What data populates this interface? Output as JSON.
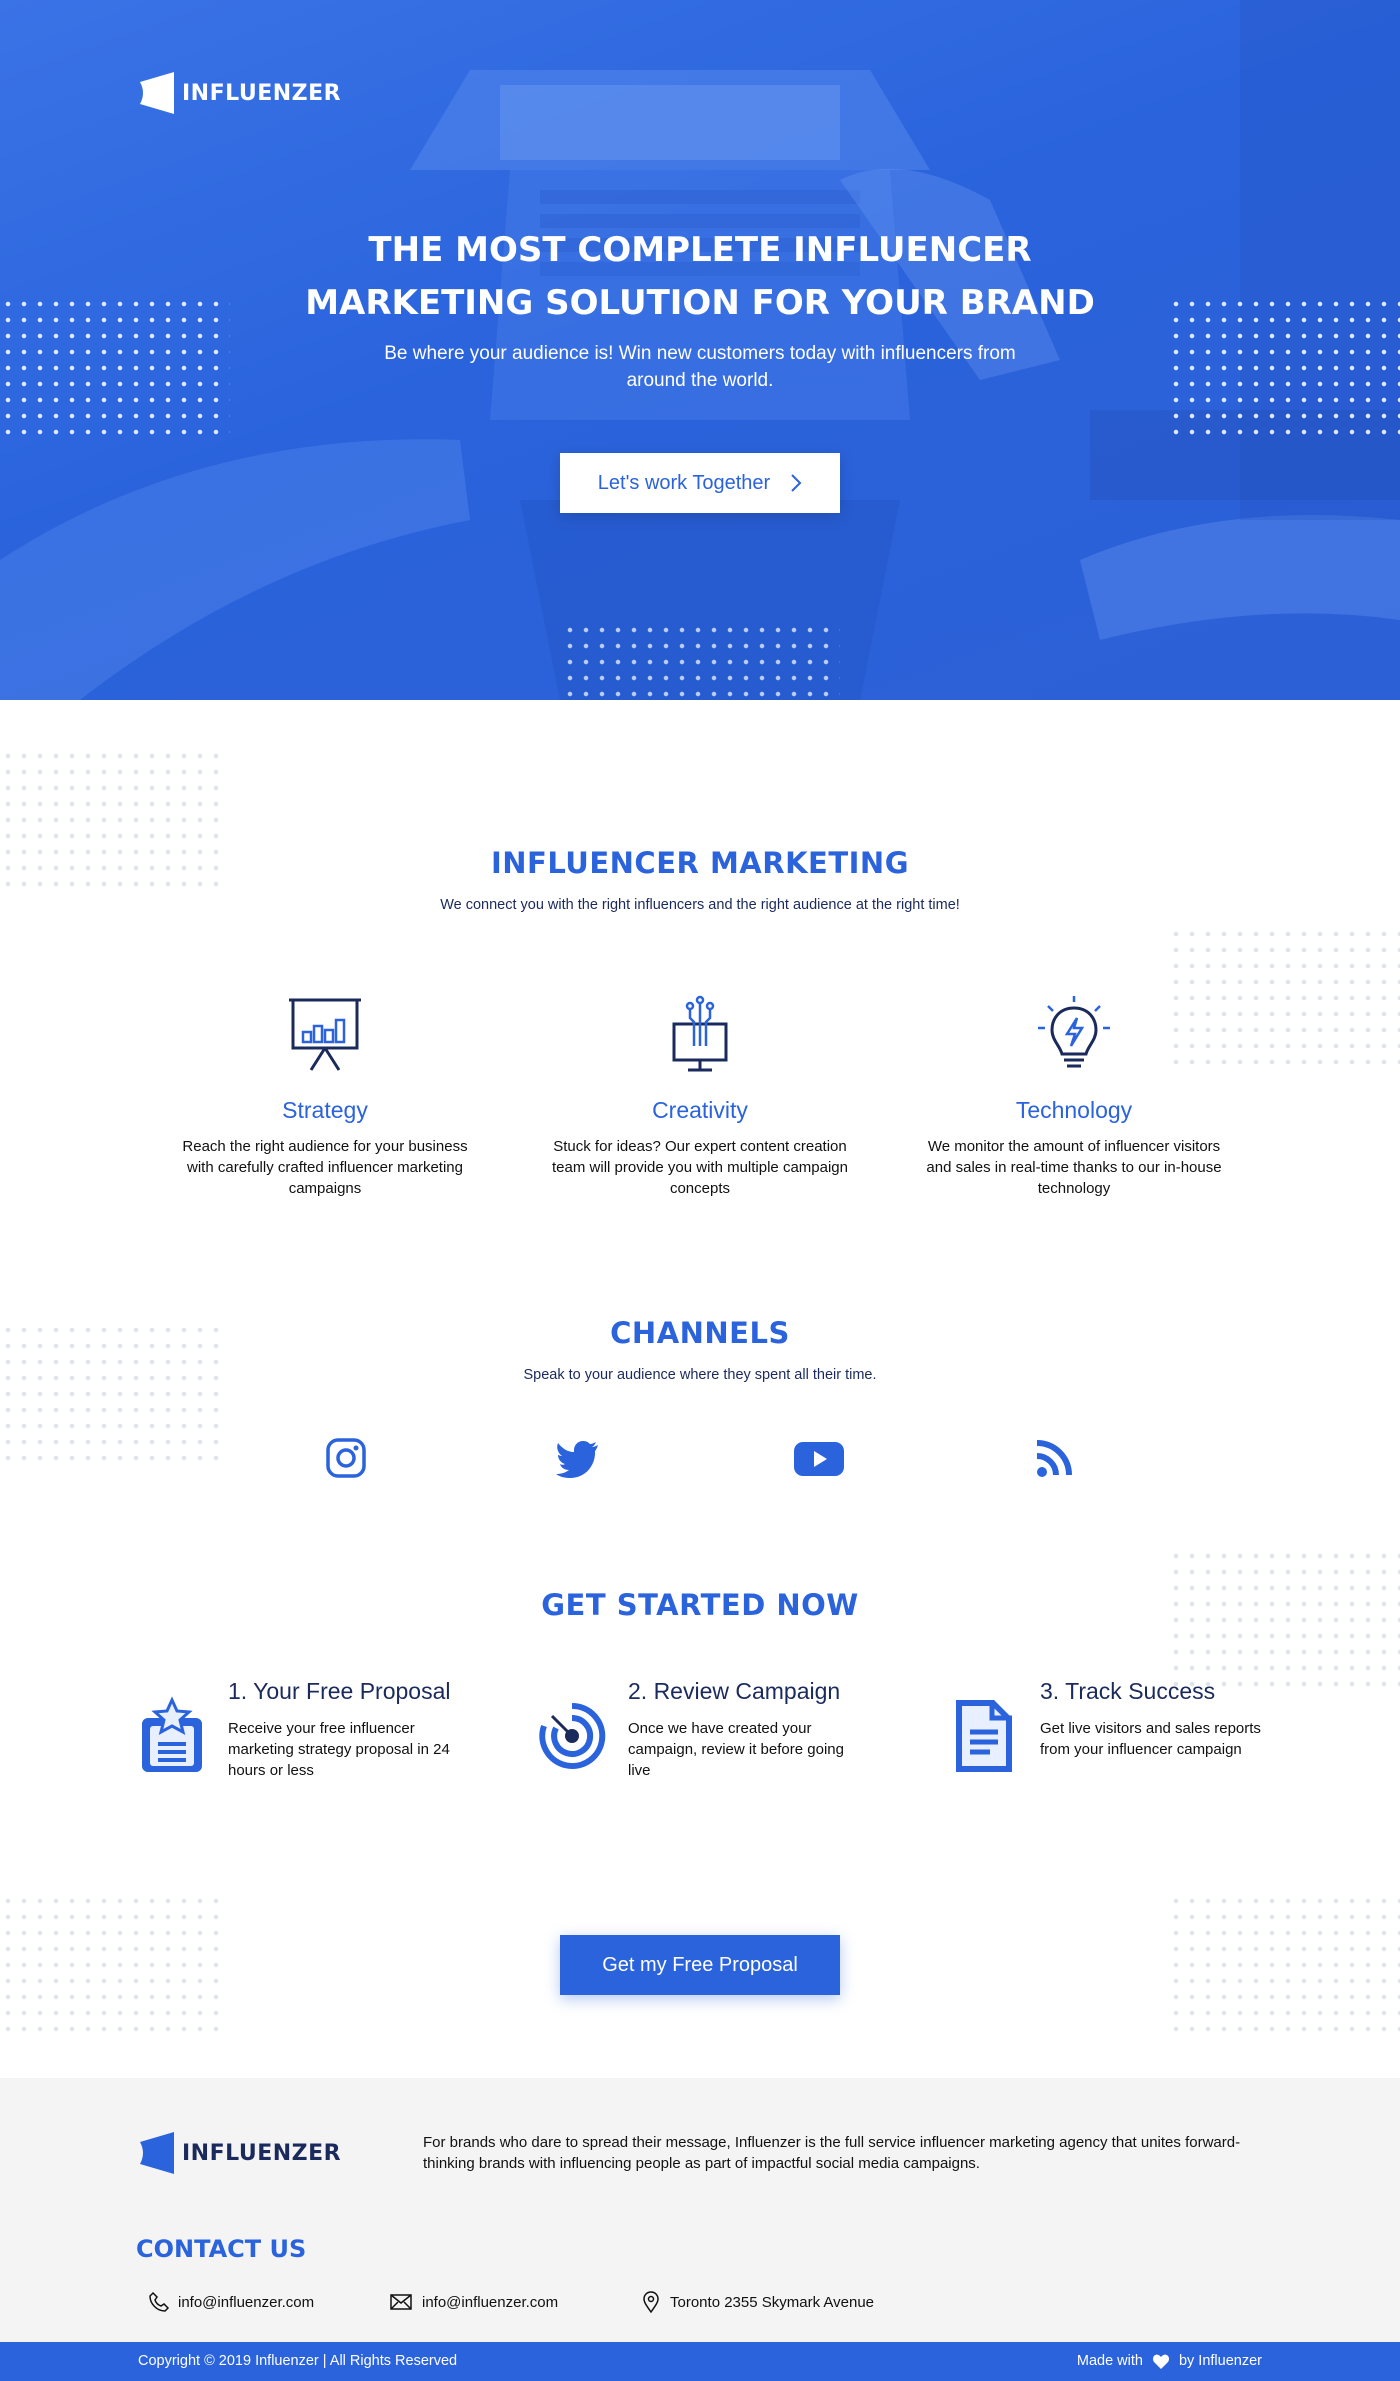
{
  "brand": {
    "name": "INFLUENZER",
    "accent": "#2a63dc",
    "dark": "#1b2a5c"
  },
  "hero": {
    "title": "THE MOST COMPLETE INFLUENCER MARKETING SOLUTION FOR YOUR BRAND",
    "subtitle": "Be where your audience is! Win new customers today with influencers from around the world.",
    "button_label": "Let's work Together",
    "button_icon": "chevron-right-icon"
  },
  "marketing": {
    "title": "INFLUENCER MARKETING",
    "subtitle": "We connect you with the right influencers and the right audience at the right time!",
    "features": [
      {
        "icon": "presentation-board-icon",
        "title": "Strategy",
        "text": "Reach the right audience for your business with carefully crafted influencer marketing campaigns"
      },
      {
        "icon": "monitor-circuit-icon",
        "title": "Creativity",
        "text": "Stuck for ideas? Our expert content creation team will provide you with multiple campaign concepts"
      },
      {
        "icon": "lightbulb-icon",
        "title": "Technology",
        "text": "We monitor the amount of influencer visitors and sales in real-time thanks to our in-house technology"
      }
    ]
  },
  "channels": {
    "title": "CHANNELS",
    "subtitle": "Speak to your audience where they spent all their time.",
    "icons": [
      "instagram-icon",
      "twitter-icon",
      "youtube-icon",
      "rss-icon"
    ]
  },
  "get_started": {
    "title": "GET STARTED NOW",
    "steps": [
      {
        "icon": "clipboard-star-icon",
        "title": "1. Your Free Proposal",
        "text": "Receive your free influencer marketing strategy proposal in 24 hours or less"
      },
      {
        "icon": "target-icon",
        "title": "2. Review Campaign",
        "text": "Once we have created your campaign, review it before going live"
      },
      {
        "icon": "document-icon",
        "title": "3. Track Success",
        "text": "Get live visitors and sales reports from your influencer campaign"
      }
    ],
    "cta_label": "Get my Free Proposal"
  },
  "footer": {
    "about": "For brands who dare to spread their message, Influenzer is the full service influencer marketing agency that unites forward-thinking brands with influencing people as part of impactful social media campaigns.",
    "contact_title": "CONTACT US",
    "contacts": [
      {
        "icon": "phone-icon",
        "text": "info@influenzer.com"
      },
      {
        "icon": "mail-icon",
        "text": "info@influenzer.com"
      },
      {
        "icon": "location-pin-icon",
        "text": "Toronto 2355 Skymark Avenue"
      }
    ],
    "copyright": "Copyright © 2019 Influenzer | All Rights Reserved",
    "made_with_prefix": "Made with",
    "made_with_suffix": "by Influenzer"
  }
}
